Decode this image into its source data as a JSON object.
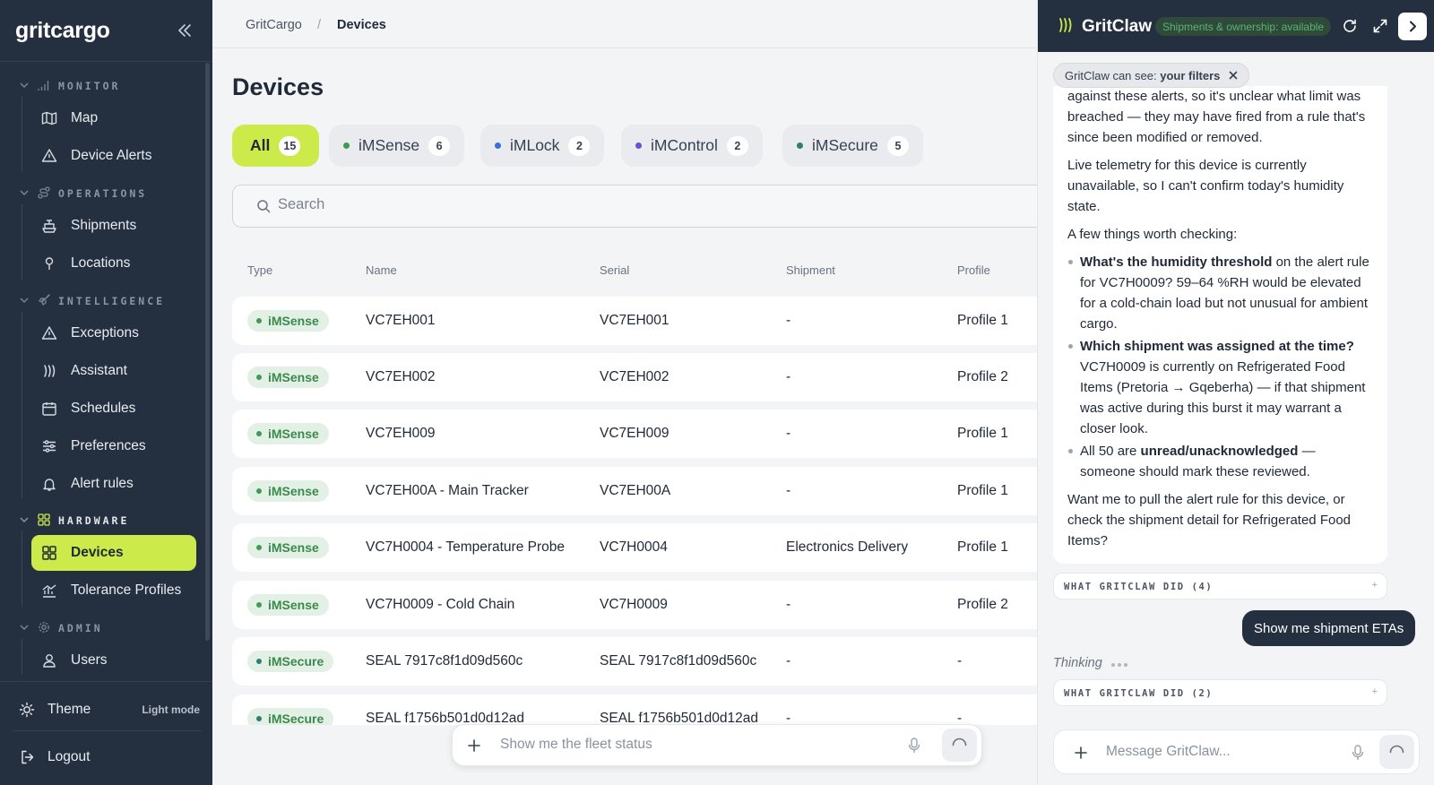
{
  "sidebar": {
    "brand": "gritcargo",
    "sections": [
      {
        "label": "MONITOR",
        "items": [
          {
            "label": "Map"
          },
          {
            "label": "Device Alerts"
          }
        ]
      },
      {
        "label": "OPERATIONS",
        "items": [
          {
            "label": "Shipments"
          },
          {
            "label": "Locations"
          }
        ]
      },
      {
        "label": "INTELLIGENCE",
        "items": [
          {
            "label": "Exceptions"
          },
          {
            "label": "Assistant"
          },
          {
            "label": "Schedules"
          },
          {
            "label": "Preferences"
          },
          {
            "label": "Alert rules"
          }
        ]
      },
      {
        "label": "HARDWARE",
        "items": [
          {
            "label": "Devices"
          },
          {
            "label": "Tolerance Profiles"
          }
        ]
      },
      {
        "label": "ADMIN",
        "items": [
          {
            "label": "Users"
          }
        ]
      }
    ],
    "theme_label": "Theme",
    "theme_value": "Light mode",
    "logout_label": "Logout",
    "accent": "#cdea4b",
    "background": "#243040"
  },
  "breadcrumb": {
    "root": "GritCargo",
    "separator": "/",
    "current": "Devices"
  },
  "page_title": "Devices",
  "filters": [
    {
      "label": "All",
      "count": "15",
      "selected": true
    },
    {
      "label": "iMSense",
      "count": "6",
      "color": "#3f9b53"
    },
    {
      "label": "iMLock",
      "count": "2",
      "color": "#3b6fd8"
    },
    {
      "label": "iMControl",
      "count": "2",
      "color": "#6a4fd1"
    },
    {
      "label": "iMSecure",
      "count": "5",
      "color": "#2f7f6f"
    }
  ],
  "search": {
    "placeholder": "Search"
  },
  "table": {
    "headers": [
      "Type",
      "Name",
      "Serial",
      "Shipment",
      "Profile"
    ],
    "rows": [
      {
        "type": "iMSense",
        "name": "VC7EH001",
        "serial": "VC7EH001",
        "shipment": "-",
        "profile": "Profile 1"
      },
      {
        "type": "iMSense",
        "name": "VC7EH002",
        "serial": "VC7EH002",
        "shipment": "-",
        "profile": "Profile 2"
      },
      {
        "type": "iMSense",
        "name": "VC7EH009",
        "serial": "VC7EH009",
        "shipment": "-",
        "profile": "Profile 1"
      },
      {
        "type": "iMSense",
        "name": "VC7EH00A - Main Tracker",
        "serial": "VC7EH00A",
        "shipment": "-",
        "profile": "Profile 1"
      },
      {
        "type": "iMSense",
        "name": "VC7H0004 - Temperature Probe",
        "serial": "VC7H0004",
        "shipment": "Electronics Delivery",
        "profile": "Profile 1"
      },
      {
        "type": "iMSense",
        "name": "VC7H0009 - Cold Chain",
        "serial": "VC7H0009",
        "shipment": "-",
        "profile": "Profile 2"
      },
      {
        "type": "iMSecure",
        "name": "SEAL 7917c8f1d09d560c",
        "serial": "SEAL 7917c8f1d09d560c",
        "shipment": "-",
        "profile": "-"
      },
      {
        "type": "iMSecure",
        "name": "SEAL f1756b501d0d12ad",
        "serial": "SEAL f1756b501d0d12ad",
        "shipment": "-",
        "profile": "-"
      }
    ]
  },
  "chatbar": {
    "placeholder": "Show me the fleet status"
  },
  "panel": {
    "title": "GritClaw",
    "badge": "Shipments & ownership: available",
    "context_prefix": "GritClaw can see: ",
    "context_value": "your filters",
    "message": {
      "p1": "against these alerts, so it's unclear what limit was breached — they may have fired from a rule that's since been modified or removed.",
      "p2": "Live telemetry for this device is currently unavailable, so I can't confirm today's humidity state.",
      "p3": "A few things worth checking:",
      "b1_strong": "What's the humidity threshold",
      "b1_rest": " on the alert rule for VC7H0009? 59–64 %RH would be elevated for a cold-chain load but not unusual for ambient cargo.",
      "b2_strong": "Which shipment was assigned at the time?",
      "b2_rest": " VC7H0009 is currently on Refrigerated Food Items (Pretoria → Gqeberha) — if that shipment was active during this burst it may warrant a closer look.",
      "b3_pre": "All 50 are ",
      "b3_strong": "unread/unacknowledged",
      "b3_rest": " — someone should mark these reviewed.",
      "p4": "Want me to pull the alert rule for this device, or check the shipment detail for Refrigerated Food Items?"
    },
    "did1": "WHAT GRITCLAW DID (4)",
    "did2": "WHAT GRITCLAW DID (2)",
    "user_message": "Show me shipment ETAs",
    "thinking": "Thinking",
    "input_placeholder": "Message GritClaw..."
  }
}
